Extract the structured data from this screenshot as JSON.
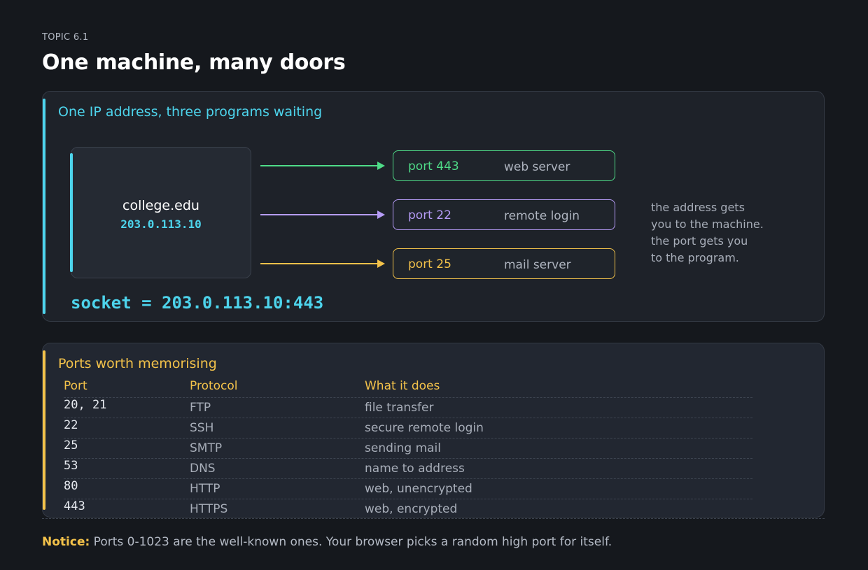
{
  "header": {
    "topic": "TOPIC 6.1",
    "title": "One machine, many doors"
  },
  "colors": {
    "cyan": "#4dd4ec",
    "green": "#4fdc88",
    "purple": "#b69cf7",
    "yellow": "#f3c24a"
  },
  "diagram": {
    "title": "One IP address, three programs waiting",
    "machine": {
      "host": "college.edu",
      "ip": "203.0.113.10"
    },
    "ports": [
      {
        "port": "port 443",
        "service": "web server",
        "color": "#4fdc88"
      },
      {
        "port": "port 22",
        "service": "remote login",
        "color": "#b69cf7"
      },
      {
        "port": "port 25",
        "service": "mail server",
        "color": "#f3c24a"
      }
    ],
    "note_lines": [
      "the address gets",
      "you to the machine.",
      "the port gets you",
      "to the program."
    ],
    "socket": "socket = 203.0.113.10:443"
  },
  "ports_table": {
    "title": "Ports worth memorising",
    "headers": [
      "Port",
      "Protocol",
      "What it does"
    ],
    "rows": [
      {
        "port": "20, 21",
        "protocol": "FTP",
        "what": "file transfer"
      },
      {
        "port": "22",
        "protocol": "SSH",
        "what": "secure remote login"
      },
      {
        "port": "25",
        "protocol": "SMTP",
        "what": "sending mail"
      },
      {
        "port": "53",
        "protocol": "DNS",
        "what": "name to address"
      },
      {
        "port": "80",
        "protocol": "HTTP",
        "what": "web, unencrypted"
      },
      {
        "port": "443",
        "protocol": "HTTPS",
        "what": "web, encrypted"
      }
    ]
  },
  "notice": {
    "lead": "Notice:",
    "text": " Ports 0-1023 are the well-known ones. Your browser picks a random high port for itself."
  }
}
